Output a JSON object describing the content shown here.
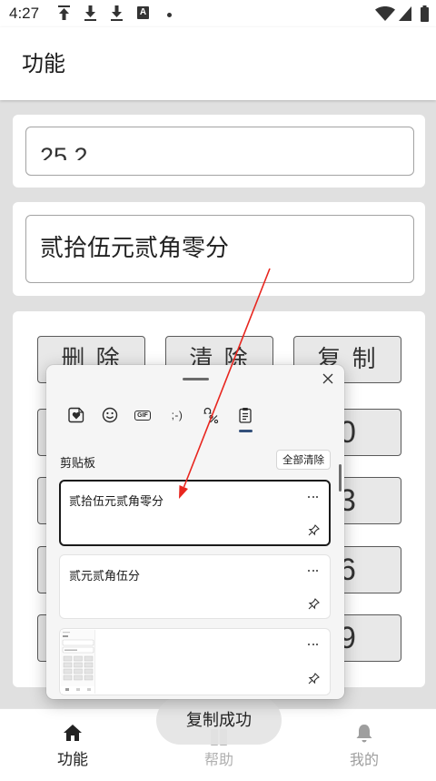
{
  "status_bar": {
    "time": "4:27",
    "left_icons": [
      "upload-icon",
      "download-icon",
      "download-icon",
      "font-box-icon",
      "dot-icon"
    ],
    "font_box_glyph": "A",
    "right_icons": [
      "wifi-icon",
      "signal-icon",
      "battery-icon"
    ]
  },
  "app_bar": {
    "title": "功能"
  },
  "amount_input": {
    "value": "25.2"
  },
  "result_output": {
    "value": "贰拾伍元贰角零分"
  },
  "keypad": {
    "actions": [
      "删 除",
      "清 除",
      "复 制"
    ],
    "right_column_digits": [
      "0",
      "3",
      "6",
      "9"
    ]
  },
  "clipboard_panel": {
    "tabs": [
      {
        "icon": "sticker-icon"
      },
      {
        "icon": "emoji-icon"
      },
      {
        "icon": "gif-icon",
        "glyph": "GIF"
      },
      {
        "icon": "kaomoji-icon",
        "glyph": ";-)"
      },
      {
        "icon": "symbols-icon"
      },
      {
        "icon": "clipboard-icon",
        "active": true
      }
    ],
    "close_icon": "close-icon",
    "section_title": "剪贴板",
    "clear_all_label": "全部清除",
    "items": [
      {
        "type": "text",
        "text": "贰拾伍元贰角零分",
        "selected": true,
        "icons": [
          "more-icon",
          "pin-icon"
        ]
      },
      {
        "type": "text",
        "text": "贰元贰角伍分",
        "selected": false,
        "icons": [
          "more-icon",
          "pin-icon"
        ]
      },
      {
        "type": "image",
        "selected": false,
        "icons": [
          "more-icon",
          "pin-icon"
        ]
      }
    ]
  },
  "toast": {
    "text": "复制成功"
  },
  "bottom_nav": {
    "items": [
      {
        "label": "功能",
        "icon": "home-icon",
        "active": true
      },
      {
        "label": "帮助",
        "icon": "help-icon",
        "active": false
      },
      {
        "label": "我的",
        "icon": "bell-icon",
        "active": false
      }
    ]
  },
  "colors": {
    "page_bg": "#e0e0e0",
    "key_bg": "#e8e8e8",
    "tab_accent": "#33507a",
    "selection_border": "#1b1b1b",
    "arrow": "#e8261f",
    "nav_active": "#222222",
    "nav_inactive": "#9e9e9e"
  }
}
